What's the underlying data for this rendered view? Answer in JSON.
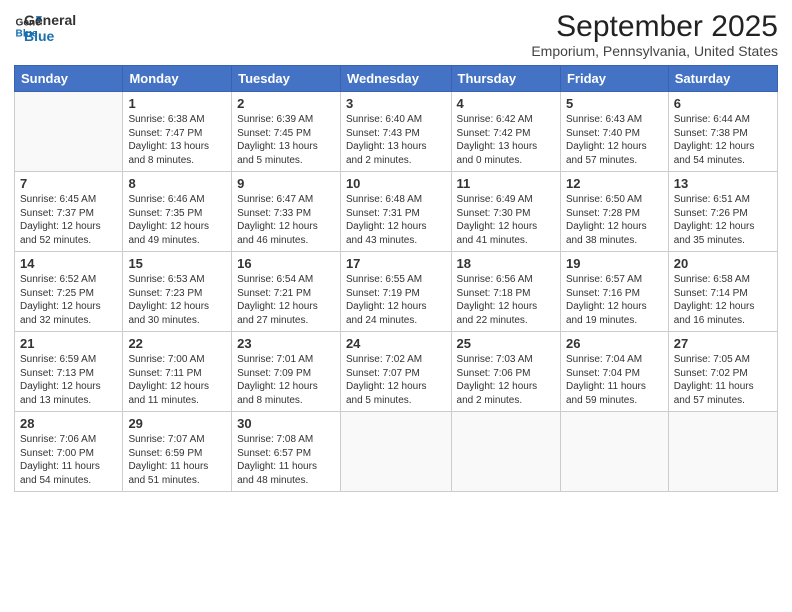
{
  "logo": {
    "line1": "General",
    "line2": "Blue"
  },
  "title": "September 2025",
  "location": "Emporium, Pennsylvania, United States",
  "days_of_week": [
    "Sunday",
    "Monday",
    "Tuesday",
    "Wednesday",
    "Thursday",
    "Friday",
    "Saturday"
  ],
  "weeks": [
    [
      {
        "day": "",
        "info": ""
      },
      {
        "day": "1",
        "info": "Sunrise: 6:38 AM\nSunset: 7:47 PM\nDaylight: 13 hours\nand 8 minutes."
      },
      {
        "day": "2",
        "info": "Sunrise: 6:39 AM\nSunset: 7:45 PM\nDaylight: 13 hours\nand 5 minutes."
      },
      {
        "day": "3",
        "info": "Sunrise: 6:40 AM\nSunset: 7:43 PM\nDaylight: 13 hours\nand 2 minutes."
      },
      {
        "day": "4",
        "info": "Sunrise: 6:42 AM\nSunset: 7:42 PM\nDaylight: 13 hours\nand 0 minutes."
      },
      {
        "day": "5",
        "info": "Sunrise: 6:43 AM\nSunset: 7:40 PM\nDaylight: 12 hours\nand 57 minutes."
      },
      {
        "day": "6",
        "info": "Sunrise: 6:44 AM\nSunset: 7:38 PM\nDaylight: 12 hours\nand 54 minutes."
      }
    ],
    [
      {
        "day": "7",
        "info": "Sunrise: 6:45 AM\nSunset: 7:37 PM\nDaylight: 12 hours\nand 52 minutes."
      },
      {
        "day": "8",
        "info": "Sunrise: 6:46 AM\nSunset: 7:35 PM\nDaylight: 12 hours\nand 49 minutes."
      },
      {
        "day": "9",
        "info": "Sunrise: 6:47 AM\nSunset: 7:33 PM\nDaylight: 12 hours\nand 46 minutes."
      },
      {
        "day": "10",
        "info": "Sunrise: 6:48 AM\nSunset: 7:31 PM\nDaylight: 12 hours\nand 43 minutes."
      },
      {
        "day": "11",
        "info": "Sunrise: 6:49 AM\nSunset: 7:30 PM\nDaylight: 12 hours\nand 41 minutes."
      },
      {
        "day": "12",
        "info": "Sunrise: 6:50 AM\nSunset: 7:28 PM\nDaylight: 12 hours\nand 38 minutes."
      },
      {
        "day": "13",
        "info": "Sunrise: 6:51 AM\nSunset: 7:26 PM\nDaylight: 12 hours\nand 35 minutes."
      }
    ],
    [
      {
        "day": "14",
        "info": "Sunrise: 6:52 AM\nSunset: 7:25 PM\nDaylight: 12 hours\nand 32 minutes."
      },
      {
        "day": "15",
        "info": "Sunrise: 6:53 AM\nSunset: 7:23 PM\nDaylight: 12 hours\nand 30 minutes."
      },
      {
        "day": "16",
        "info": "Sunrise: 6:54 AM\nSunset: 7:21 PM\nDaylight: 12 hours\nand 27 minutes."
      },
      {
        "day": "17",
        "info": "Sunrise: 6:55 AM\nSunset: 7:19 PM\nDaylight: 12 hours\nand 24 minutes."
      },
      {
        "day": "18",
        "info": "Sunrise: 6:56 AM\nSunset: 7:18 PM\nDaylight: 12 hours\nand 22 minutes."
      },
      {
        "day": "19",
        "info": "Sunrise: 6:57 AM\nSunset: 7:16 PM\nDaylight: 12 hours\nand 19 minutes."
      },
      {
        "day": "20",
        "info": "Sunrise: 6:58 AM\nSunset: 7:14 PM\nDaylight: 12 hours\nand 16 minutes."
      }
    ],
    [
      {
        "day": "21",
        "info": "Sunrise: 6:59 AM\nSunset: 7:13 PM\nDaylight: 12 hours\nand 13 minutes."
      },
      {
        "day": "22",
        "info": "Sunrise: 7:00 AM\nSunset: 7:11 PM\nDaylight: 12 hours\nand 11 minutes."
      },
      {
        "day": "23",
        "info": "Sunrise: 7:01 AM\nSunset: 7:09 PM\nDaylight: 12 hours\nand 8 minutes."
      },
      {
        "day": "24",
        "info": "Sunrise: 7:02 AM\nSunset: 7:07 PM\nDaylight: 12 hours\nand 5 minutes."
      },
      {
        "day": "25",
        "info": "Sunrise: 7:03 AM\nSunset: 7:06 PM\nDaylight: 12 hours\nand 2 minutes."
      },
      {
        "day": "26",
        "info": "Sunrise: 7:04 AM\nSunset: 7:04 PM\nDaylight: 11 hours\nand 59 minutes."
      },
      {
        "day": "27",
        "info": "Sunrise: 7:05 AM\nSunset: 7:02 PM\nDaylight: 11 hours\nand 57 minutes."
      }
    ],
    [
      {
        "day": "28",
        "info": "Sunrise: 7:06 AM\nSunset: 7:00 PM\nDaylight: 11 hours\nand 54 minutes."
      },
      {
        "day": "29",
        "info": "Sunrise: 7:07 AM\nSunset: 6:59 PM\nDaylight: 11 hours\nand 51 minutes."
      },
      {
        "day": "30",
        "info": "Sunrise: 7:08 AM\nSunset: 6:57 PM\nDaylight: 11 hours\nand 48 minutes."
      },
      {
        "day": "",
        "info": ""
      },
      {
        "day": "",
        "info": ""
      },
      {
        "day": "",
        "info": ""
      },
      {
        "day": "",
        "info": ""
      }
    ]
  ]
}
